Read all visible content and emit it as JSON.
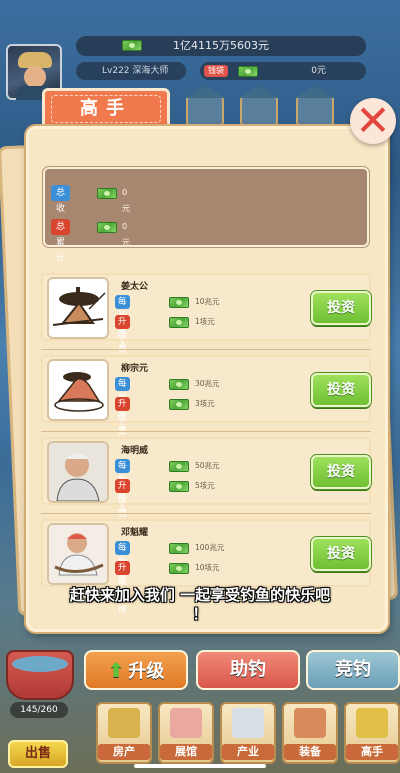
{
  "top": {
    "total_money": "1亿4115万5603元",
    "title": "Lv222 深海大师",
    "pass_tag": "钱袋",
    "pass_value": "0元"
  },
  "panel": {
    "tab_title": "高手",
    "stats": {
      "income_label": "总收入",
      "income_value": "0元",
      "total_label": "总累计",
      "total_value": "0元"
    },
    "masters": [
      {
        "name": "姜太公",
        "income_label": "每秒收入",
        "income_value": "10兆元",
        "cost_label": "升级费用",
        "cost_value": "1垓元",
        "button": "投资"
      },
      {
        "name": "柳宗元",
        "income_label": "每秒收入",
        "income_value": "30兆元",
        "cost_label": "升级费用",
        "cost_value": "3垓元",
        "button": "投资"
      },
      {
        "name": "海明威",
        "income_label": "每秒收入",
        "income_value": "50兆元",
        "cost_label": "升级费用",
        "cost_value": "5垓元",
        "button": "投资"
      },
      {
        "name": "邓魁耀",
        "income_label": "每秒收入",
        "income_value": "100兆元",
        "cost_label": "升级费用",
        "cost_value": "10垓元",
        "button": "投资"
      }
    ]
  },
  "subtitle_line1": "赶快来加入我们 一起享受钓鱼的快乐吧",
  "subtitle_line2": "！",
  "bottom": {
    "capacity": "145/260",
    "sell": "出售",
    "upgrade": "升级",
    "help": "助钓",
    "compete": "竞钓",
    "nav": [
      "房产",
      "展馆",
      "产业",
      "装备",
      "高手"
    ]
  },
  "colors": {
    "income_tag": "#3b8fd6",
    "cost_tag": "#d9452f",
    "invest_button": "#7dcc3f",
    "tab_head": "#f07a4e"
  }
}
